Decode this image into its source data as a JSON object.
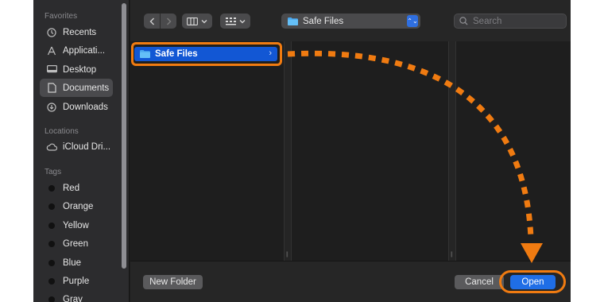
{
  "sidebar": {
    "favorites_heading": "Favorites",
    "favorites": [
      {
        "label": "Recents",
        "icon": "clock-icon"
      },
      {
        "label": "Applicati...",
        "icon": "applications-icon"
      },
      {
        "label": "Desktop",
        "icon": "desktop-icon"
      },
      {
        "label": "Documents",
        "icon": "document-icon",
        "selected": true
      },
      {
        "label": "Downloads",
        "icon": "download-icon"
      }
    ],
    "locations_heading": "Locations",
    "locations": [
      {
        "label": "iCloud Dri...",
        "icon": "cloud-icon"
      }
    ],
    "tags_heading": "Tags",
    "tags": [
      "Red",
      "Orange",
      "Yellow",
      "Green",
      "Blue",
      "Purple",
      "Gray"
    ]
  },
  "toolbar": {
    "location": "Safe Files",
    "search_placeholder": "Search"
  },
  "browser": {
    "selected_item": "Safe Files"
  },
  "footer": {
    "new_folder_label": "New Folder",
    "cancel_label": "Cancel",
    "open_label": "Open"
  },
  "colors": {
    "accent": "#1f6ee6",
    "annotation": "#f07b11"
  }
}
